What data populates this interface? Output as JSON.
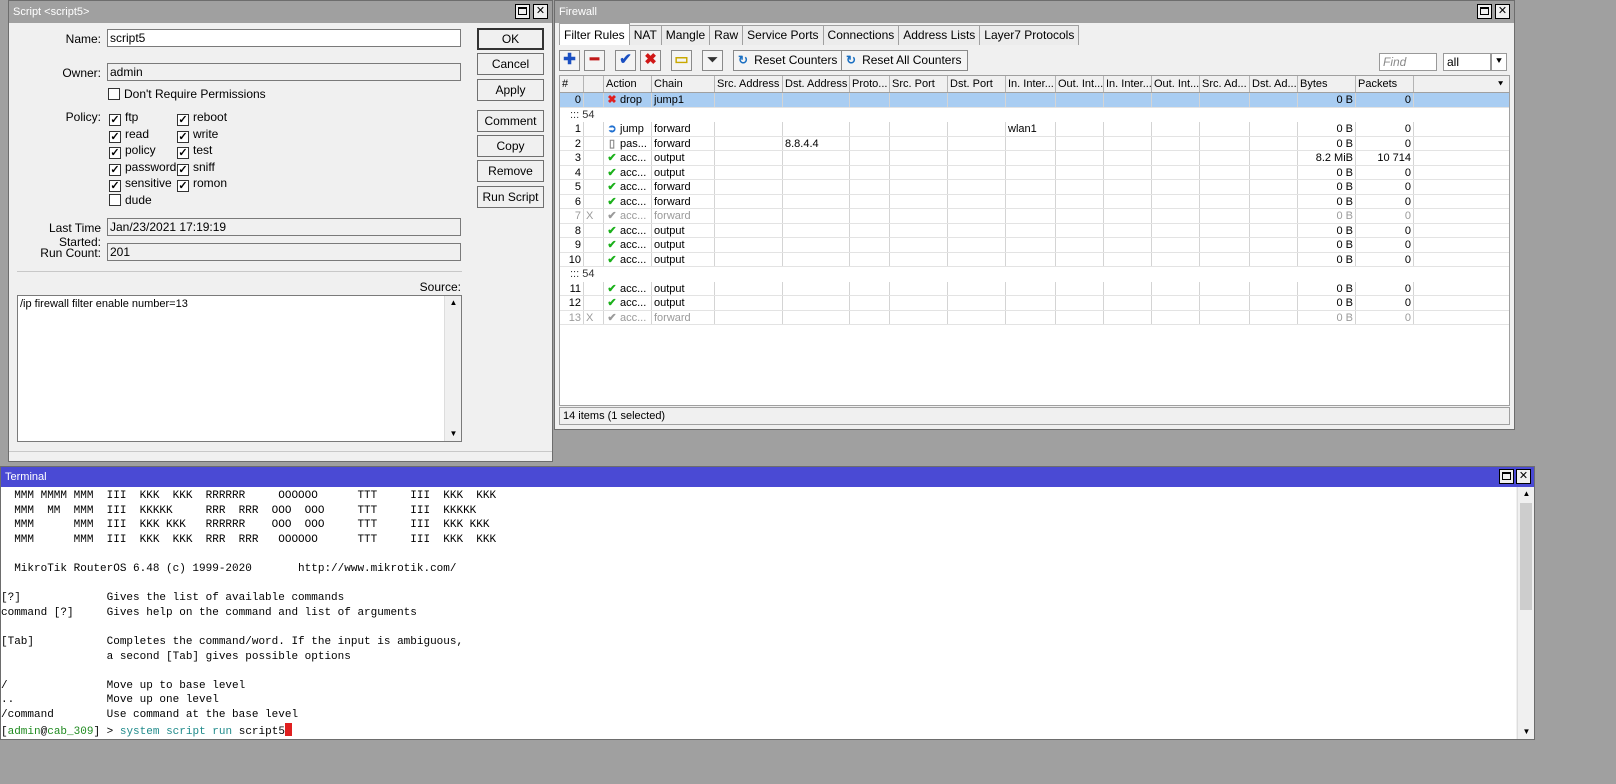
{
  "script_window": {
    "title": "Script <script5>",
    "name_label": "Name:",
    "name_value": "script5",
    "owner_label": "Owner:",
    "owner_value": "admin",
    "dont_require_label": "Don't Require Permissions",
    "policy_label": "Policy:",
    "policies": [
      {
        "label": "ftp",
        "checked": true
      },
      {
        "label": "reboot",
        "checked": true
      },
      {
        "label": "read",
        "checked": true
      },
      {
        "label": "write",
        "checked": true
      },
      {
        "label": "policy",
        "checked": true
      },
      {
        "label": "test",
        "checked": true
      },
      {
        "label": "password",
        "checked": true
      },
      {
        "label": "sniff",
        "checked": true
      },
      {
        "label": "sensitive",
        "checked": true
      },
      {
        "label": "romon",
        "checked": true
      },
      {
        "label": "dude",
        "checked": false
      }
    ],
    "last_started_label": "Last Time Started:",
    "last_started_value": "Jan/23/2021 17:19:19",
    "run_count_label": "Run Count:",
    "run_count_value": "201",
    "source_label": "Source:",
    "source_value": "/ip firewall filter enable number=13",
    "buttons": {
      "ok": "OK",
      "cancel": "Cancel",
      "apply": "Apply",
      "comment": "Comment",
      "copy": "Copy",
      "remove": "Remove",
      "run_script": "Run Script"
    }
  },
  "firewall": {
    "title": "Firewall",
    "tabs": [
      "Filter Rules",
      "NAT",
      "Mangle",
      "Raw",
      "Service Ports",
      "Connections",
      "Address Lists",
      "Layer7 Protocols"
    ],
    "active_tab": "Filter Rules",
    "toolbar": {
      "reset_counters": "Reset Counters",
      "reset_all_counters": "Reset All Counters",
      "find_placeholder": "Find",
      "filter_value": "all"
    },
    "columns": [
      "#",
      "",
      "Action",
      "Chain",
      "Src. Address",
      "Dst. Address",
      "Proto...",
      "Src. Port",
      "Dst. Port",
      "In. Inter...",
      "Out. Int...",
      "In. Inter...",
      "Out. Int...",
      "Src. Ad...",
      "Dst. Ad...",
      "Bytes",
      "Packets"
    ],
    "rows": [
      {
        "type": "rule",
        "num": "0",
        "flag": "",
        "icon": "drop",
        "action": "drop",
        "chain": "jump1",
        "dst": "",
        "in_if": "",
        "bytes": "0 B",
        "packets": "0",
        "selected": true
      },
      {
        "type": "comment",
        "text": "::: 54"
      },
      {
        "type": "rule",
        "num": "1",
        "flag": "",
        "icon": "jump",
        "action": "jump",
        "chain": "forward",
        "dst": "",
        "in_if": "wlan1",
        "bytes": "0 B",
        "packets": "0"
      },
      {
        "type": "rule",
        "num": "2",
        "flag": "",
        "icon": "pass",
        "action": "pas...",
        "chain": "forward",
        "dst": "8.8.4.4",
        "in_if": "",
        "bytes": "0 B",
        "packets": "0"
      },
      {
        "type": "rule",
        "num": "3",
        "flag": "",
        "icon": "accept",
        "action": "acc...",
        "chain": "output",
        "dst": "",
        "in_if": "",
        "bytes": "8.2 MiB",
        "packets": "10 714"
      },
      {
        "type": "rule",
        "num": "4",
        "flag": "",
        "icon": "accept",
        "action": "acc...",
        "chain": "output",
        "dst": "",
        "in_if": "",
        "bytes": "0 B",
        "packets": "0"
      },
      {
        "type": "rule",
        "num": "5",
        "flag": "",
        "icon": "accept",
        "action": "acc...",
        "chain": "forward",
        "dst": "",
        "in_if": "",
        "bytes": "0 B",
        "packets": "0"
      },
      {
        "type": "rule",
        "num": "6",
        "flag": "",
        "icon": "accept",
        "action": "acc...",
        "chain": "forward",
        "dst": "",
        "in_if": "",
        "bytes": "0 B",
        "packets": "0"
      },
      {
        "type": "rule",
        "num": "7",
        "flag": "X",
        "icon": "accept",
        "action": "acc...",
        "chain": "forward",
        "dst": "",
        "in_if": "",
        "bytes": "0 B",
        "packets": "0",
        "disabled": true
      },
      {
        "type": "rule",
        "num": "8",
        "flag": "",
        "icon": "accept",
        "action": "acc...",
        "chain": "output",
        "dst": "",
        "in_if": "",
        "bytes": "0 B",
        "packets": "0"
      },
      {
        "type": "rule",
        "num": "9",
        "flag": "",
        "icon": "accept",
        "action": "acc...",
        "chain": "output",
        "dst": "",
        "in_if": "",
        "bytes": "0 B",
        "packets": "0"
      },
      {
        "type": "rule",
        "num": "10",
        "flag": "",
        "icon": "accept",
        "action": "acc...",
        "chain": "output",
        "dst": "",
        "in_if": "",
        "bytes": "0 B",
        "packets": "0"
      },
      {
        "type": "comment",
        "text": "::: 54"
      },
      {
        "type": "rule",
        "num": "11",
        "flag": "",
        "icon": "accept",
        "action": "acc...",
        "chain": "output",
        "dst": "",
        "in_if": "",
        "bytes": "0 B",
        "packets": "0"
      },
      {
        "type": "rule",
        "num": "12",
        "flag": "",
        "icon": "accept",
        "action": "acc...",
        "chain": "output",
        "dst": "",
        "in_if": "",
        "bytes": "0 B",
        "packets": "0"
      },
      {
        "type": "rule",
        "num": "13",
        "flag": "X",
        "icon": "accept",
        "action": "acc...",
        "chain": "forward",
        "dst": "",
        "in_if": "",
        "bytes": "0 B",
        "packets": "0",
        "disabled": true
      }
    ],
    "status": "14 items (1 selected)"
  },
  "terminal": {
    "title": "Terminal",
    "lines": [
      "  MMM MMMM MMM  III  KKK  KKK  RRRRRR     OOOOOO      TTT     III  KKK  KKK",
      "  MMM  MM  MMM  III  KKKKK     RRR  RRR  OOO  OOO     TTT     III  KKKKK",
      "  MMM      MMM  III  KKK KKK   RRRRRR    OOO  OOO     TTT     III  KKK KKK",
      "  MMM      MMM  III  KKK  KKK  RRR  RRR   OOOOOO      TTT     III  KKK  KKK",
      "",
      "  MikroTik RouterOS 6.48 (c) 1999-2020       http://www.mikrotik.com/",
      "",
      "[?]             Gives the list of available commands",
      "command [?]     Gives help on the command and list of arguments",
      "",
      "[Tab]           Completes the command/word. If the input is ambiguous,",
      "                a second [Tab] gives possible options",
      "",
      "/               Move up to base level",
      "..              Move up one level",
      "/command        Use command at the base level"
    ],
    "prompt": {
      "open": "[",
      "user": "admin",
      "at": "@",
      "host": "cab_309",
      "close": "] > ",
      "cmd1": "system",
      "cmd2": "script",
      "cmd3": "run",
      "arg": "script5"
    }
  }
}
